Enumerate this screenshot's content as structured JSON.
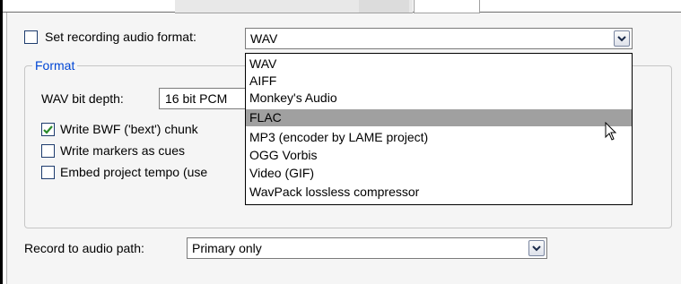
{
  "recording_format": {
    "checkbox_checked": false,
    "label": "Set recording audio format:",
    "selected_value": "WAV"
  },
  "format_dropdown": {
    "options": [
      "WAV",
      "AIFF",
      "Monkey's Audio",
      "FLAC",
      "MP3 (encoder by LAME project)",
      "OGG Vorbis",
      "Video (GIF)",
      "WavPack lossless compressor"
    ],
    "highlighted": "FLAC"
  },
  "format_group": {
    "title": "Format",
    "wav_bit_depth_label": "WAV bit depth:",
    "wav_bit_depth_value": "16 bit PCM",
    "write_bwf": {
      "label": "Write BWF ('bext') chunk",
      "checked": true
    },
    "write_markers": {
      "label": "Write markers as cues",
      "checked": false
    },
    "embed_tempo": {
      "label": "Embed project tempo (use",
      "checked": false
    }
  },
  "record_path": {
    "label": "Record to audio path:",
    "value": "Primary only"
  },
  "colors": {
    "highlight": "#a0a0a0",
    "group_title": "#0046d5",
    "checkmark": "#2a8a2a",
    "panel_bg": "#f5f5f5"
  },
  "icons": {
    "dropdown_arrow": "chevron-down-icon",
    "checkmark": "check-icon",
    "cursor": "mouse-pointer-icon"
  }
}
